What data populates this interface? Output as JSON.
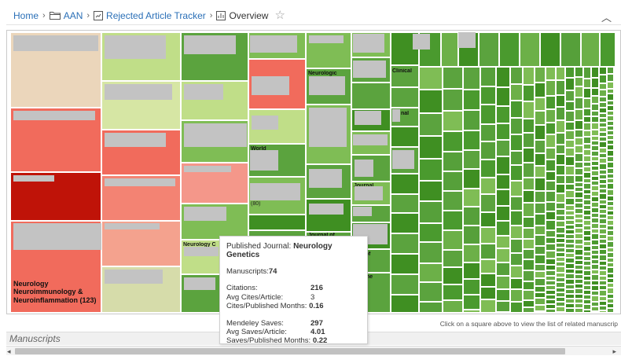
{
  "breadcrumb": {
    "home": "Home",
    "folder": "AAN",
    "tracker": "Rejected Article Tracker",
    "current": "Overview"
  },
  "colors": {
    "peach": "#ebd6bb",
    "salmon": "#f16b5c",
    "deep_red": "#bf1308",
    "light_salmon": "#f4a28e",
    "tan_green": "#d6dcaa",
    "light_green": "#c0de88",
    "mid_green": "#7fbd55",
    "green": "#5ba33e",
    "dark_green": "#3f8f22",
    "pink": "#f4978a"
  },
  "treemap": {
    "visible_labels": [
      "Neurology Neuroimmunology & Neuroinflammation (123)",
      "Journal of",
      "rnal of",
      "adache",
      "Clinical",
      "(80)",
      "Neurologic",
      "Neurology C",
      "Journal",
      "World",
      "nal"
    ]
  },
  "tooltip": {
    "title_prefix": "Published Journal: ",
    "journal": "Neurology Genetics",
    "manuscripts_label": "Manuscripts: ",
    "manuscripts_value": "74",
    "citations_label": "Citations:",
    "citations_value": "216",
    "avg_cites_label": "Avg Cites/Article:",
    "avg_cites_value": "3",
    "cites_pm_label": "Cites/Published Months:",
    "cites_pm_value": "0.16",
    "saves_label": "Mendeley Saves:",
    "saves_value": "297",
    "avg_saves_label": "Avg Saves/Article:",
    "avg_saves_value": "4.01",
    "saves_pm_label": "Saves/Published Months:",
    "saves_pm_value": "0.22"
  },
  "hint": "Click on a square above to view the list of related manuscrip",
  "section": {
    "title": "Manuscripts"
  }
}
